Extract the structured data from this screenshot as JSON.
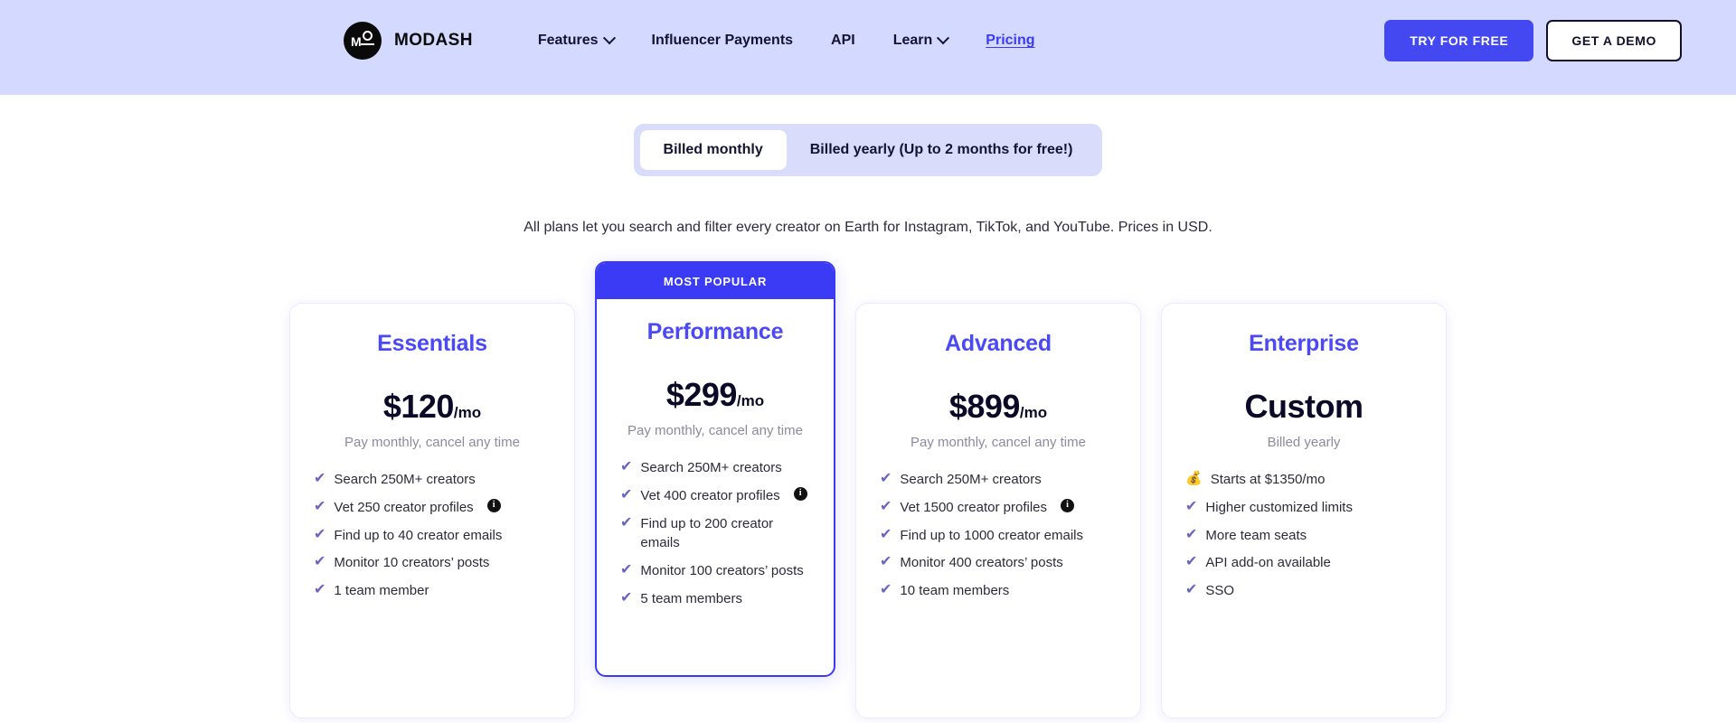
{
  "header": {
    "brand": {
      "name": "MODASH",
      "logo_icon": "modash-logo-icon"
    },
    "nav": [
      {
        "label": "Features",
        "has_chevron": true
      },
      {
        "label": "Influencer Payments",
        "has_chevron": false
      },
      {
        "label": "API",
        "has_chevron": false
      },
      {
        "label": "Learn",
        "has_chevron": true
      },
      {
        "label": "Pricing",
        "has_chevron": false,
        "active_link": true
      }
    ],
    "actions": {
      "primary": "TRY FOR FREE",
      "secondary": "GET A DEMO"
    },
    "background_color": "#d4daff",
    "accent_color": "#4448f0"
  },
  "billing_toggle": {
    "monthly_label": "Billed monthly",
    "yearly_label": "Billed yearly (Up to 2 months for free!)",
    "selected": "Billed monthly"
  },
  "subtitle": "All plans let you search and filter every creator on Earth for Instagram, TikTok, and YouTube. Prices in USD.",
  "featured_badge": "MOST POPULAR",
  "plans": [
    {
      "name": "Essentials",
      "price": "$120",
      "price_suffix": "/mo",
      "price_note": "Pay monthly, cancel any time",
      "featured": false,
      "features": [
        {
          "icon": "check-icon",
          "text": "Search 250M+ creators",
          "info": false
        },
        {
          "icon": "check-icon",
          "text": "Vet 250 creator profiles",
          "info": true
        },
        {
          "icon": "check-icon",
          "text": "Find up to 40 creator emails",
          "info": false
        },
        {
          "icon": "check-icon",
          "text": "Monitor 10 creators’ posts",
          "info": false
        },
        {
          "icon": "check-icon",
          "text": "1 team member",
          "info": false
        }
      ]
    },
    {
      "name": "Performance",
      "price": "$299",
      "price_suffix": "/mo",
      "price_note": "Pay monthly, cancel any time",
      "featured": true,
      "features": [
        {
          "icon": "check-icon",
          "text": "Search 250M+ creators",
          "info": false
        },
        {
          "icon": "check-icon",
          "text": "Vet 400 creator profiles",
          "info": true
        },
        {
          "icon": "check-icon",
          "text": "Find up to 200 creator emails",
          "info": false
        },
        {
          "icon": "check-icon",
          "text": "Monitor 100 creators’ posts",
          "info": false
        },
        {
          "icon": "check-icon",
          "text": "5 team members",
          "info": false
        }
      ]
    },
    {
      "name": "Advanced",
      "price": "$899",
      "price_suffix": "/mo",
      "price_note": "Pay monthly, cancel any time",
      "featured": false,
      "features": [
        {
          "icon": "check-icon",
          "text": "Search 250M+ creators",
          "info": false
        },
        {
          "icon": "check-icon",
          "text": "Vet 1500 creator profiles",
          "info": true
        },
        {
          "icon": "check-icon",
          "text": "Find up to 1000 creator emails",
          "info": false
        },
        {
          "icon": "check-icon",
          "text": "Monitor 400 creators’ posts",
          "info": false
        },
        {
          "icon": "check-icon",
          "text": "10 team members",
          "info": false
        }
      ]
    },
    {
      "name": "Enterprise",
      "price": "Custom",
      "price_suffix": "",
      "price_note": "Billed yearly",
      "featured": false,
      "features": [
        {
          "icon": "money-bag-icon",
          "text": "Starts at $1350/mo",
          "info": false
        },
        {
          "icon": "check-icon",
          "text": "Higher customized limits",
          "info": false
        },
        {
          "icon": "check-icon",
          "text": "More team seats",
          "info": false
        },
        {
          "icon": "check-icon",
          "text": "API add-on available",
          "info": false
        },
        {
          "icon": "check-icon",
          "text": "SSO",
          "info": false
        }
      ]
    }
  ],
  "glyphs": {
    "check": "✔",
    "money_bag": "💰",
    "info": "i"
  }
}
